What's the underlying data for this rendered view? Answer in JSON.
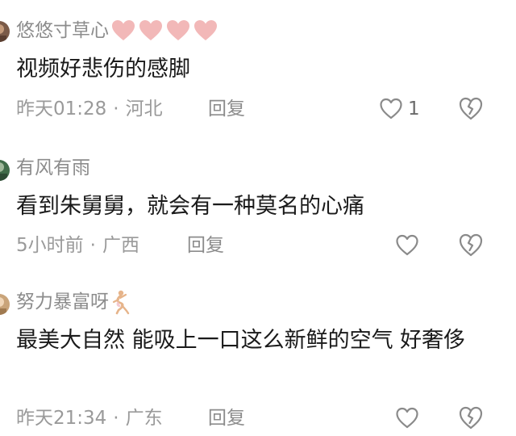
{
  "comments": [
    {
      "username": "悠悠寸草心",
      "badge_icons": [
        "pink-heart-icon",
        "pink-heart-icon",
        "pink-heart-icon",
        "pink-heart-icon"
      ],
      "text": "视频好悲伤的感脚",
      "time": "昨天01:28",
      "separator": "·",
      "location": "河北",
      "reply_label": "回复",
      "like_count": "1",
      "avatar_color": "#7a5a48"
    },
    {
      "username": "有风有雨",
      "badge_icons": [],
      "text": "看到朱舅舅，就会有一种莫名的心痛",
      "time": "5小时前",
      "separator": "·",
      "location": "广西",
      "reply_label": "回复",
      "like_count": "",
      "avatar_color": "#3f6b48"
    },
    {
      "username": "努力暴富呀",
      "badge_icons": [
        "dancer-icon"
      ],
      "text": "最美大自然 能吸上一口这么新鲜的空气 好奢侈",
      "time": "昨天21:34",
      "separator": "·",
      "location": "广东",
      "reply_label": "回复",
      "like_count": "",
      "avatar_color": "#c9a47a"
    }
  ],
  "colors": {
    "username": "#8c8c8c",
    "text": "#1a1a1a",
    "meta": "#9a9a9a",
    "icon_stroke": "#8a8a8a",
    "badge_heart_fill": "#f2b8b8"
  }
}
